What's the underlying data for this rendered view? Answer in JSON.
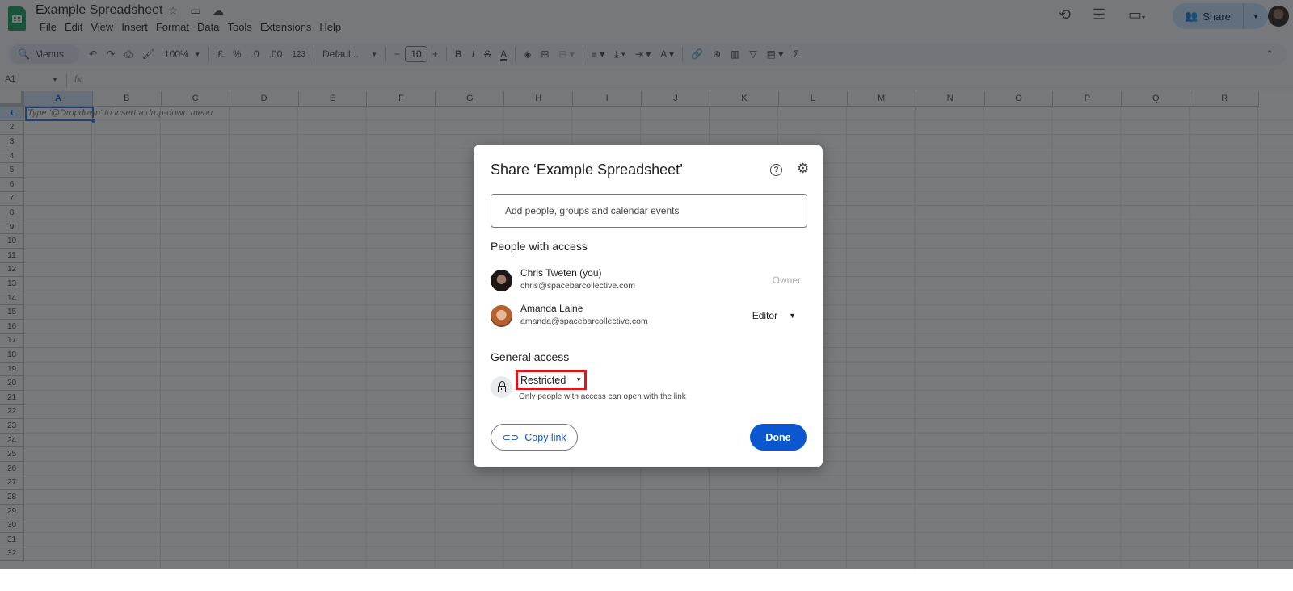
{
  "app": {
    "doc_title": "Example Spreadsheet",
    "title_icons": [
      "star-icon",
      "move-to-folder-icon",
      "cloud-saved-icon"
    ],
    "menu": [
      "File",
      "Edit",
      "View",
      "Insert",
      "Format",
      "Data",
      "Tools",
      "Extensions",
      "Help"
    ],
    "share_label": "Share",
    "top_icons": [
      "version-history-icon",
      "comments-icon",
      "meet-icon"
    ]
  },
  "toolbar": {
    "search_label": "Menus",
    "zoom": "100%",
    "currency": "£",
    "percent": "%",
    "decrease_decimal": ".0",
    "increase_decimal": ".00",
    "number_format": "123",
    "font": "Defaul...",
    "font_size": "10",
    "minus": "−",
    "plus": "+",
    "bold": "B",
    "italic": "I",
    "strikethrough": "S",
    "text_color": "A",
    "sum": "Σ"
  },
  "formula_bar": {
    "cell_ref": "A1",
    "fx": "fx"
  },
  "grid": {
    "columns": [
      "A",
      "B",
      "C",
      "D",
      "E",
      "F",
      "G",
      "H",
      "I",
      "J",
      "K",
      "L",
      "M",
      "N",
      "O",
      "P",
      "Q",
      "R"
    ],
    "rows": [
      "1",
      "2",
      "3",
      "4",
      "5",
      "6",
      "7",
      "8",
      "9",
      "10",
      "11",
      "12",
      "13",
      "14",
      "15",
      "16",
      "17",
      "18",
      "19",
      "20",
      "21",
      "22",
      "23",
      "24",
      "25",
      "26",
      "27",
      "28",
      "29",
      "30",
      "31",
      "32"
    ],
    "selected_cell": "A1",
    "cell_hint": "Type '@Dropdown' to insert a drop-down menu"
  },
  "dialog": {
    "title": "Share ‘Example Spreadsheet’",
    "add_placeholder": "Add people, groups and calendar events",
    "people_heading": "People with access",
    "people": [
      {
        "name": "Chris Tweten (you)",
        "email": "chris@spacebarcollective.com",
        "role": "Owner"
      },
      {
        "name": "Amanda Laine",
        "email": "amanda@spacebarcollective.com",
        "role": "Editor"
      }
    ],
    "general_heading": "General access",
    "access_level": "Restricted",
    "access_desc": "Only people with access can open with the link",
    "copy_link": "Copy link",
    "done": "Done"
  }
}
